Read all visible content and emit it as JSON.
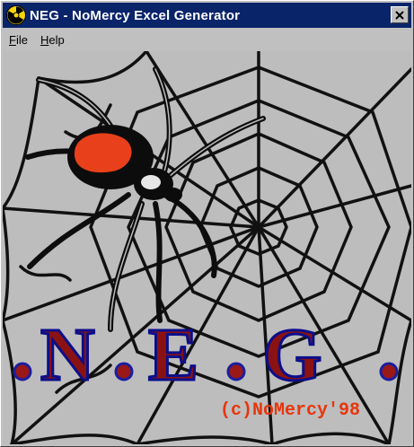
{
  "window": {
    "title": "NEG - NoMercy Excel Generator",
    "close_label": "×"
  },
  "menu": {
    "items": [
      "File",
      "Help"
    ]
  },
  "artwork": {
    "logo_letters": [
      "N",
      "E",
      "G"
    ],
    "copyright": "(c)NoMercy'98"
  },
  "colors": {
    "titlebar": "#0a246a",
    "window": "#c0c0c0",
    "logo_fill": "#8b1212",
    "logo_outline": "#0b0f8a",
    "copyright": "#e8350c"
  },
  "icons": [
    "radiation-icon",
    "close-icon",
    "spider-icon",
    "spiderweb"
  ]
}
